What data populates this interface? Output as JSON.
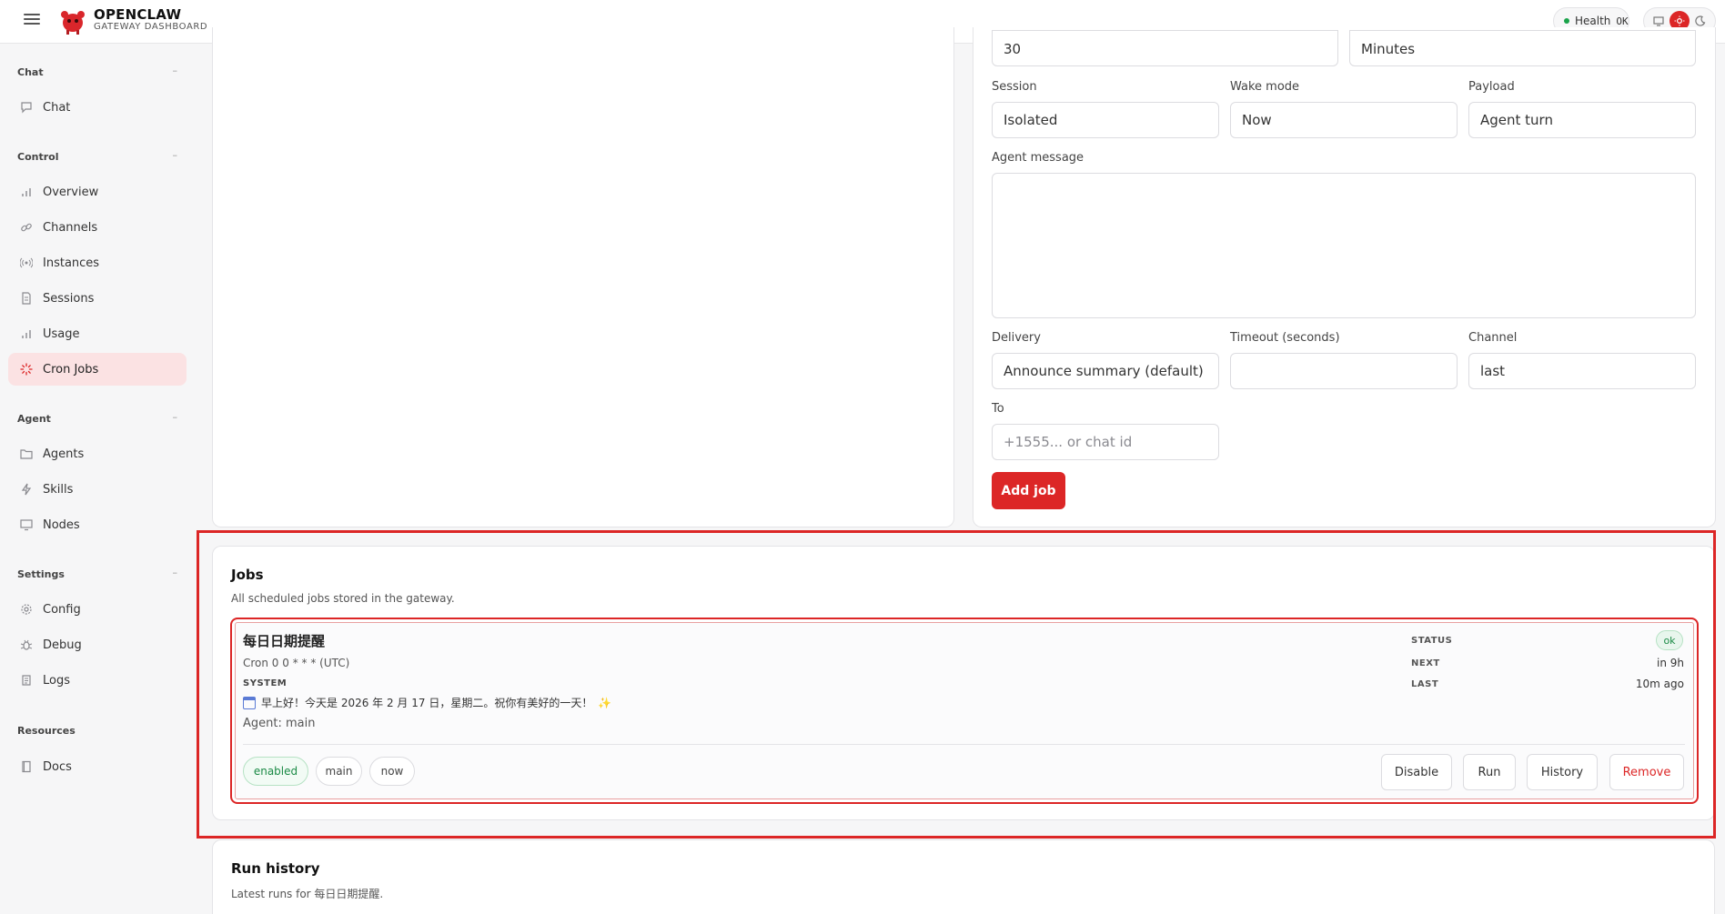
{
  "header": {
    "brand_title": "OPENCLAW",
    "brand_subtitle": "GATEWAY DASHBOARD",
    "health_label": "Health",
    "health_value": "OK"
  },
  "sidebar": {
    "sections": [
      {
        "label": "Chat",
        "items": [
          {
            "label": "Chat",
            "icon": "chat-bubble-icon"
          }
        ]
      },
      {
        "label": "Control",
        "items": [
          {
            "label": "Overview",
            "icon": "bar-chart-icon"
          },
          {
            "label": "Channels",
            "icon": "link-icon"
          },
          {
            "label": "Instances",
            "icon": "radio-icon"
          },
          {
            "label": "Sessions",
            "icon": "document-icon"
          },
          {
            "label": "Usage",
            "icon": "bar-chart-icon"
          },
          {
            "label": "Cron Jobs",
            "icon": "loader-icon",
            "active": true
          }
        ]
      },
      {
        "label": "Agent",
        "items": [
          {
            "label": "Agents",
            "icon": "folder-icon"
          },
          {
            "label": "Skills",
            "icon": "lightning-icon"
          },
          {
            "label": "Nodes",
            "icon": "monitor-icon"
          }
        ]
      },
      {
        "label": "Settings",
        "items": [
          {
            "label": "Config",
            "icon": "gear-icon"
          },
          {
            "label": "Debug",
            "icon": "bug-icon"
          },
          {
            "label": "Logs",
            "icon": "scroll-icon"
          }
        ]
      },
      {
        "label": "Resources",
        "items": [
          {
            "label": "Docs",
            "icon": "book-icon"
          }
        ]
      }
    ]
  },
  "form": {
    "every_value": "30",
    "unit_value": "Minutes",
    "session_label": "Session",
    "session_value": "Isolated",
    "wake_label": "Wake mode",
    "wake_value": "Now",
    "payload_label": "Payload",
    "payload_value": "Agent turn",
    "agent_message_label": "Agent message",
    "delivery_label": "Delivery",
    "delivery_value": "Announce summary (default)",
    "timeout_label": "Timeout (seconds)",
    "channel_label": "Channel",
    "channel_value": "last",
    "to_label": "To",
    "to_placeholder": "+1555... or chat id",
    "add_button": "Add job"
  },
  "jobs": {
    "title": "Jobs",
    "subtitle": "All scheduled jobs stored in the gateway.",
    "job": {
      "name": "每日日期提醒",
      "cron": "Cron 0 0 * * * (UTC)",
      "kind": "SYSTEM",
      "message": "早上好！今天是 2026 年 2 月 17 日，星期二。祝你有美好的一天！",
      "agent": "Agent: main",
      "status_label": "STATUS",
      "status_value": "ok",
      "next_label": "NEXT",
      "next_value": "in 9h",
      "last_label": "LAST",
      "last_value": "10m ago",
      "chips": [
        "enabled",
        "main",
        "now"
      ],
      "actions": {
        "disable": "Disable",
        "run": "Run",
        "history": "History",
        "remove": "Remove"
      }
    }
  },
  "run_history": {
    "title": "Run history",
    "subtitle": "Latest runs for 每日日期提醒."
  },
  "colors": {
    "accent": "#dc2626",
    "ok": "#1a8a45"
  }
}
